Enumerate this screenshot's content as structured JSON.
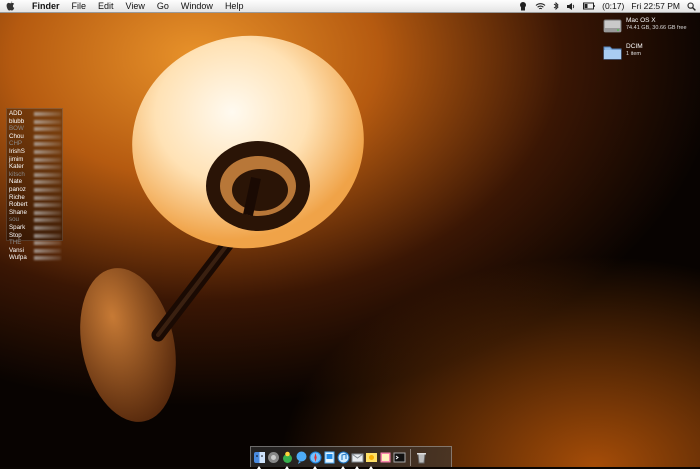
{
  "menubar": {
    "app_name": "Finder",
    "menus": [
      "File",
      "Edit",
      "View",
      "Go",
      "Window",
      "Help"
    ],
    "battery_time": "(0:17)",
    "clock": "Fri 22:57 PM"
  },
  "desktop": {
    "disk": {
      "name": "Mac OS X",
      "info": "74.41 GB, 30.66 GB free"
    },
    "folder": {
      "name": "DCIM",
      "info": "1 item"
    }
  },
  "buddy_list": [
    {
      "name": "ADD",
      "idle": false
    },
    {
      "name": "blubb",
      "idle": false
    },
    {
      "name": "BOW",
      "idle": true
    },
    {
      "name": "Chou",
      "idle": false
    },
    {
      "name": "CHP",
      "idle": true
    },
    {
      "name": "IrishS",
      "idle": false
    },
    {
      "name": "jimim",
      "idle": false
    },
    {
      "name": "Kater",
      "idle": false
    },
    {
      "name": "kitsch",
      "idle": true
    },
    {
      "name": "Nate",
      "idle": false
    },
    {
      "name": "panoz",
      "idle": false
    },
    {
      "name": "Riche",
      "idle": false
    },
    {
      "name": "Robert",
      "idle": false
    },
    {
      "name": "Shane",
      "idle": false
    },
    {
      "name": "sou",
      "idle": true
    },
    {
      "name": "Spark",
      "idle": false
    },
    {
      "name": "Stop",
      "idle": false
    },
    {
      "name": "THE",
      "idle": true
    },
    {
      "name": "Vansi",
      "idle": false
    },
    {
      "name": "Wufpa",
      "idle": false
    }
  ],
  "dock": {
    "items": [
      "finder-icon",
      "system-prefs-icon",
      "adium-icon",
      "ichat-icon",
      "safari-icon",
      "preview-icon",
      "itunes-icon",
      "mail-icon",
      "iphoto-icon",
      "stickies-icon",
      "terminal-icon"
    ],
    "running": [
      0,
      2,
      4,
      6,
      7,
      8
    ],
    "trash": "trash-icon"
  }
}
